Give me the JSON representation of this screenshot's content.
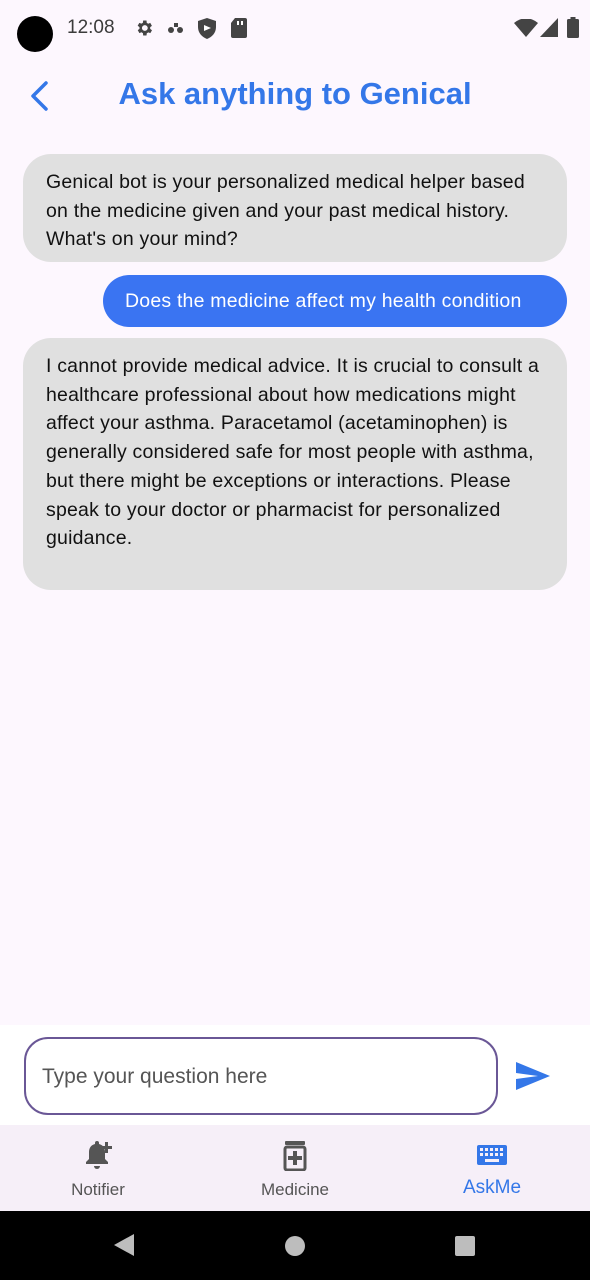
{
  "status_bar": {
    "time": "12:08",
    "icons": [
      "settings-icon",
      "dots-icon",
      "shield-icon",
      "sd-card-icon",
      "wifi-icon",
      "signal-icon",
      "battery-icon"
    ]
  },
  "header": {
    "title": "Ask anything to Genical",
    "back_icon": "chevron-left-icon"
  },
  "colors": {
    "accent": "#3477e8",
    "user_bubble": "#3a74f2",
    "bot_bubble": "#e0e0e0",
    "input_border": "#6a5796",
    "background": "#fdf7fe"
  },
  "messages": [
    {
      "role": "bot",
      "text": "Genical bot is your personalized medical helper based on the medicine given and your past medical history. What's on your mind?"
    },
    {
      "role": "user",
      "text": "Does the medicine affect my health condition"
    },
    {
      "role": "bot",
      "text": "I cannot provide medical advice. It is crucial to consult a healthcare professional about how medications might affect your asthma.  Paracetamol (acetaminophen) is generally considered safe for most people with asthma, but there might be exceptions or interactions.  Please speak to your doctor or pharmacist for personalized guidance."
    }
  ],
  "input": {
    "placeholder": "Type your question here",
    "value": "",
    "send_icon": "send-icon"
  },
  "bottom_nav": {
    "items": [
      {
        "label": "Notifier",
        "icon": "bell-plus-icon",
        "active": false
      },
      {
        "label": "Medicine",
        "icon": "medicine-bottle-icon",
        "active": false
      },
      {
        "label": "AskMe",
        "icon": "keyboard-icon",
        "active": true
      }
    ]
  },
  "system_nav": [
    "back-triangle-icon",
    "home-circle-icon",
    "recents-square-icon"
  ]
}
